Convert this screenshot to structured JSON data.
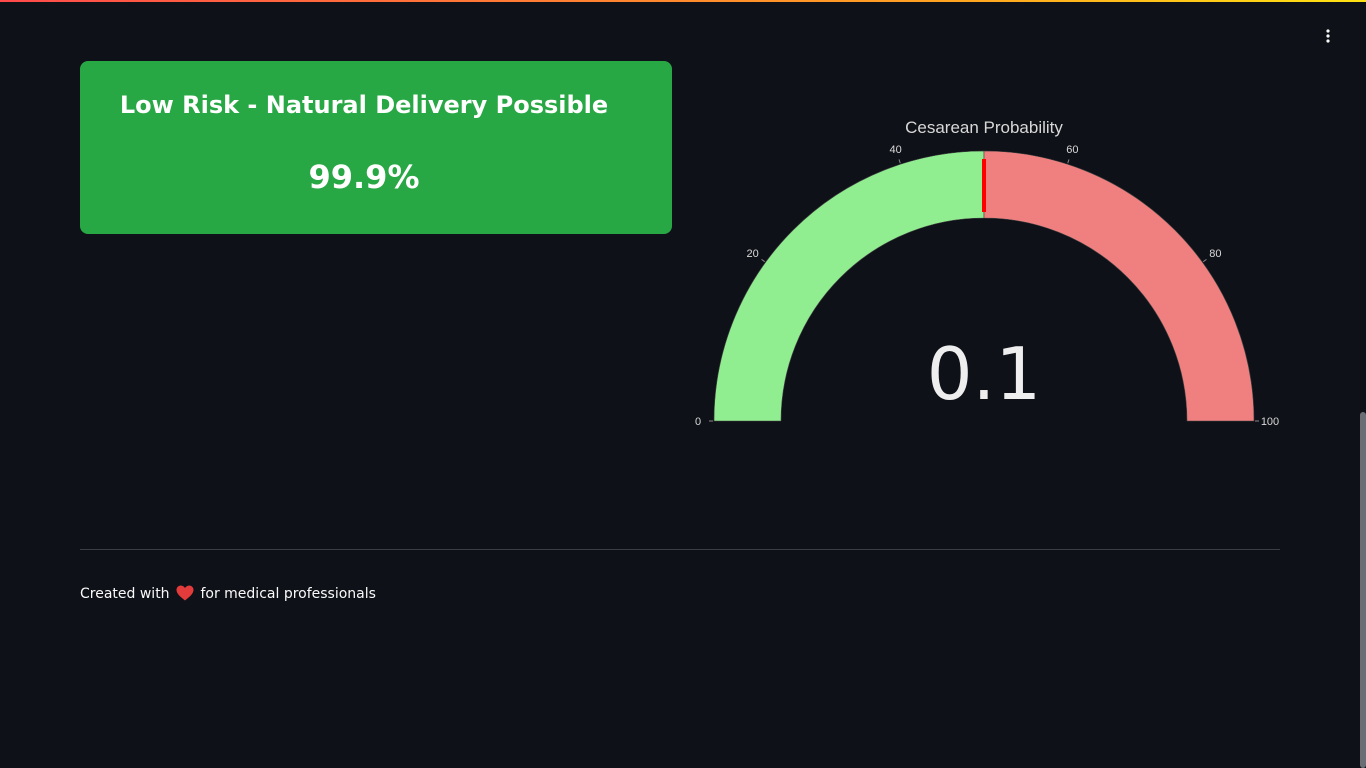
{
  "app": {
    "menu_icon": "vertical-ellipsis-icon"
  },
  "result_card": {
    "title": "Low Risk - Natural Delivery Possible",
    "value": "99.9%",
    "background": "#28a745"
  },
  "gauge": {
    "title": "Cesarean Probability",
    "value_text": "0.1",
    "value": 0.1,
    "range": [
      0,
      100
    ],
    "ticks": [
      "0",
      "20",
      "40",
      "60",
      "80",
      "100"
    ],
    "threshold": 50,
    "steps": [
      {
        "range": [
          0,
          50
        ],
        "color": "#90ee90"
      },
      {
        "range": [
          50,
          100
        ],
        "color": "#f08080"
      }
    ],
    "threshold_color": "#ff0000"
  },
  "footer": {
    "text_before": "Created with",
    "icon": "heart-icon",
    "text_after": "for medical professionals"
  }
}
